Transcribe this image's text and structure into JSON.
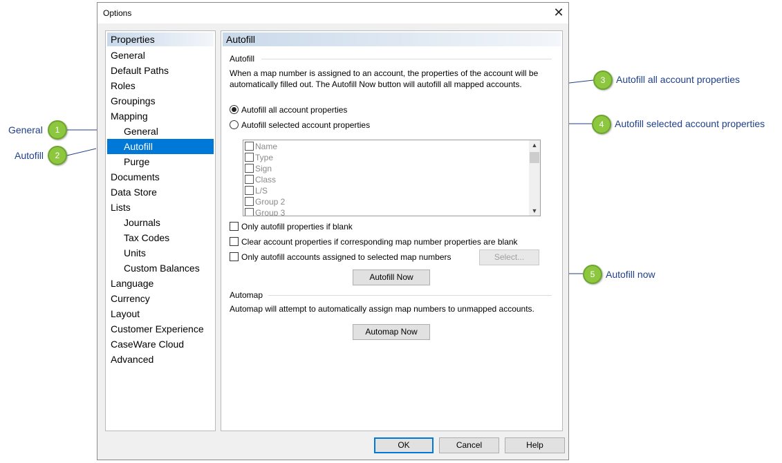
{
  "dialog": {
    "title": "Options",
    "close_glyph": "✕"
  },
  "left_panel": {
    "header": "Properties",
    "items": [
      {
        "label": "General",
        "level": 0
      },
      {
        "label": "Default Paths",
        "level": 0
      },
      {
        "label": "Roles",
        "level": 0
      },
      {
        "label": "Groupings",
        "level": 0
      },
      {
        "label": "Mapping",
        "level": 0
      },
      {
        "label": "General",
        "level": 1
      },
      {
        "label": "Autofill",
        "level": 1,
        "selected": true
      },
      {
        "label": "Purge",
        "level": 1
      },
      {
        "label": "Documents",
        "level": 0
      },
      {
        "label": "Data Store",
        "level": 0
      },
      {
        "label": "Lists",
        "level": 0
      },
      {
        "label": "Journals",
        "level": 1
      },
      {
        "label": "Tax Codes",
        "level": 1
      },
      {
        "label": "Units",
        "level": 1
      },
      {
        "label": "Custom Balances",
        "level": 1
      },
      {
        "label": "Language",
        "level": 0
      },
      {
        "label": "Currency",
        "level": 0
      },
      {
        "label": "Layout",
        "level": 0
      },
      {
        "label": "Customer Experience",
        "level": 0
      },
      {
        "label": "CaseWare Cloud",
        "level": 0
      },
      {
        "label": "Advanced",
        "level": 0
      }
    ]
  },
  "right_panel": {
    "header": "Autofill",
    "autofill_section": {
      "title": "Autofill",
      "description": "When a map number is assigned to an account, the properties of the account will be automatically filled out. The Autofill Now button will autofill all mapped accounts.",
      "radio_all": "Autofill all account properties",
      "radio_selected": "Autofill selected account properties",
      "radio_value": "all",
      "list_items": [
        "Name",
        "Type",
        "Sign",
        "Class",
        "L/S",
        "Group 2",
        "Group 3"
      ],
      "check_blank": "Only autofill properties if blank",
      "check_clear": "Clear account properties if corresponding map number properties are blank",
      "check_assigned": "Only autofill accounts assigned to selected map numbers",
      "select_button": "Select...",
      "autofill_now_button": "Autofill Now"
    },
    "automap_section": {
      "title": "Automap",
      "description": "Automap will attempt to automatically assign map numbers to unmapped accounts.",
      "automap_now_button": "Automap Now"
    }
  },
  "footer": {
    "ok": "OK",
    "cancel": "Cancel",
    "help": "Help"
  },
  "callouts": [
    {
      "number": "1",
      "label": "General"
    },
    {
      "number": "2",
      "label": "Autofill"
    },
    {
      "number": "3",
      "label": "Autofill all account properties"
    },
    {
      "number": "4",
      "label": "Autofill selected account properties"
    },
    {
      "number": "5",
      "label": "Autofill now"
    }
  ],
  "colors": {
    "selection": "#0078d7",
    "callout_badge": "#8dc63f",
    "callout_text": "#1f3f8a",
    "callout_line": "#1f3f8a"
  }
}
